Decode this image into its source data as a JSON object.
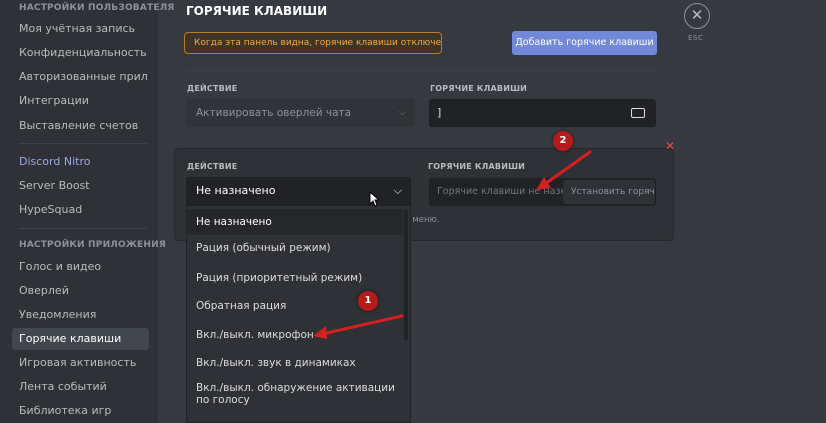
{
  "sidebar": {
    "user_settings_header": "НАСТРОЙКИ ПОЛЬЗОВАТЕЛЯ",
    "user_items": [
      {
        "label": "Моя учётная запись"
      },
      {
        "label": "Конфиденциальность"
      },
      {
        "label": "Авторизованные прил..."
      },
      {
        "label": "Интеграции"
      },
      {
        "label": "Выставление счетов"
      }
    ],
    "nitro_items": [
      {
        "label": "Discord Nitro"
      },
      {
        "label": "Server Boost"
      },
      {
        "label": "HypeSquad"
      }
    ],
    "app_settings_header": "НАСТРОЙКИ ПРИЛОЖЕНИЯ",
    "app_items": [
      {
        "label": "Голос и видео"
      },
      {
        "label": "Оверлей"
      },
      {
        "label": "Уведомления"
      },
      {
        "label": "Горячие клавиши",
        "active": true
      },
      {
        "label": "Игровая активность"
      },
      {
        "label": "Лента событий"
      },
      {
        "label": "Библиотека игр"
      }
    ]
  },
  "main": {
    "title": "ГОРЯЧИЕ КЛАВИШИ",
    "warning": "Когда эта панель видна, горячие клавиши отключены.",
    "add_button": "Добавить горячие клавиши",
    "close_icon": "close-icon",
    "esc_label": "ESC",
    "keybind1": {
      "action_label": "ДЕЙСТВИЕ",
      "action_value": "Активировать оверлей чата",
      "hotkey_label": "ГОРЯЧИЕ КЛАВИШИ",
      "hotkey_value": "]"
    },
    "keybind2": {
      "action_label": "ДЕЙСТВИЕ",
      "action_value": "Не назначено",
      "hotkey_label": "ГОРЯЧИЕ КЛАВИШИ",
      "hotkey_placeholder": "Горячие клавиши не назна...",
      "record_button": "Установить горяч",
      "hint": ", что вам нужно из выпадающего меню."
    },
    "dropdown_options": [
      {
        "label": "Не назначено"
      },
      {
        "label": "Рация (обычный режим)"
      },
      {
        "label": "Рация (приоритетный режим)"
      },
      {
        "label": "Обратная рация"
      },
      {
        "label": "Вкл./выкл. микрофон"
      },
      {
        "label": "Вкл./выкл. звук в динамиках"
      },
      {
        "label": "Вкл./выкл. обнаружение активации по голосу"
      }
    ]
  },
  "annotations": {
    "marker1": "1",
    "marker2": "2",
    "arrow_color": "#d42020"
  },
  "colors": {
    "accent": "#7289da",
    "warning": "#f7a838",
    "danger": "#f04747"
  }
}
